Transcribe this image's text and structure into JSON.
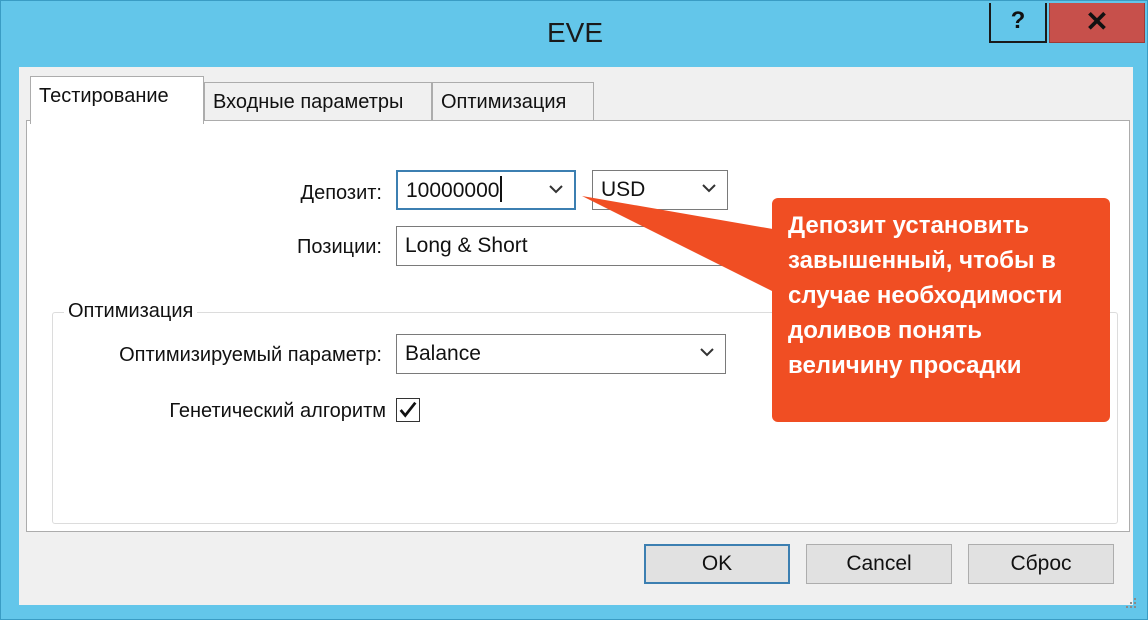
{
  "window": {
    "title": "EVE",
    "help_label": "?",
    "close_label": "✕"
  },
  "tabs": [
    {
      "label": "Тестирование",
      "active": true
    },
    {
      "label": "Входные параметры",
      "active": false
    },
    {
      "label": "Оптимизация",
      "active": false
    }
  ],
  "form": {
    "deposit_label": "Депозит:",
    "deposit_value": "10000000",
    "currency_value": "USD",
    "positions_label": "Позиции:",
    "positions_value": "Long & Short"
  },
  "optimization": {
    "group_title": "Оптимизация",
    "param_label": "Оптимизируемый параметр:",
    "param_value": "Balance",
    "genetic_label": "Генетический алгоритм",
    "genetic_checked": true
  },
  "buttons": {
    "ok_label": "OK",
    "cancel_label": "Cancel",
    "reset_label": "Сброс"
  },
  "annotation": {
    "text": "Депозит установить завышенный, чтобы в случае необходимости доливов понять величину просадки",
    "color": "#f04e23"
  },
  "icons": {
    "dropdown": "chevron-down-icon",
    "check": "checkmark-icon",
    "resize": "resize-grip-icon"
  }
}
